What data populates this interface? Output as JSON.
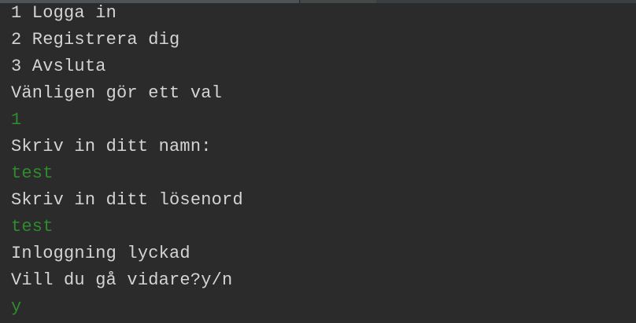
{
  "colors": {
    "background": "#2b2b2b",
    "output_text": "#d4d4d4",
    "input_text": "#2e8b2e"
  },
  "console": {
    "lines": [
      {
        "kind": "output",
        "text": "1 Logga in"
      },
      {
        "kind": "output",
        "text": "2 Registrera dig"
      },
      {
        "kind": "output",
        "text": "3 Avsluta"
      },
      {
        "kind": "output",
        "text": "Vänligen gör ett val"
      },
      {
        "kind": "input",
        "text": "1"
      },
      {
        "kind": "output",
        "text": "Skriv in ditt namn:"
      },
      {
        "kind": "input",
        "text": "test"
      },
      {
        "kind": "output",
        "text": "Skriv in ditt lösenord"
      },
      {
        "kind": "input",
        "text": "test"
      },
      {
        "kind": "output",
        "text": "Inloggning lyckad"
      },
      {
        "kind": "output",
        "text": "Vill du gå vidare?y/n"
      },
      {
        "kind": "input",
        "text": "y"
      }
    ]
  }
}
